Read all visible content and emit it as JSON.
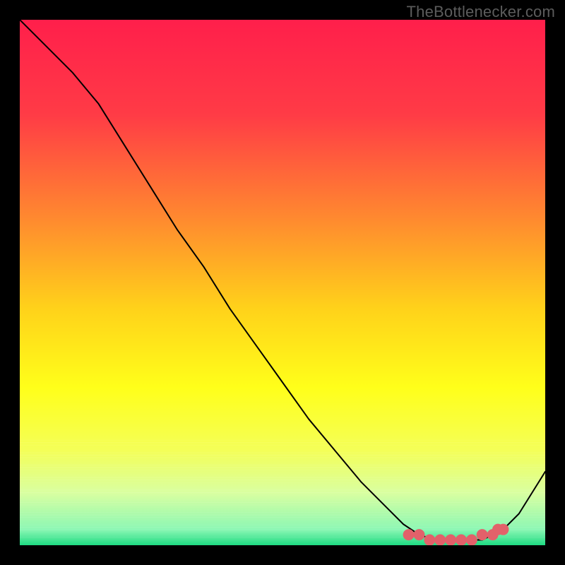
{
  "watermark": "TheBottlenecker.com",
  "chart_data": {
    "type": "line",
    "title": "",
    "xlabel": "",
    "ylabel": "",
    "xlim": [
      0,
      100
    ],
    "ylim": [
      0,
      100
    ],
    "grid": false,
    "series": [
      {
        "name": "curve",
        "x": [
          0,
          5,
          10,
          15,
          20,
          25,
          30,
          35,
          40,
          45,
          50,
          55,
          60,
          65,
          70,
          73,
          76,
          79,
          82,
          85,
          88,
          90,
          92,
          95,
          100
        ],
        "y": [
          100,
          95,
          90,
          84,
          76,
          68,
          60,
          53,
          45,
          38,
          31,
          24,
          18,
          12,
          7,
          4,
          2,
          1,
          1,
          1,
          1,
          2,
          3,
          6,
          14
        ]
      }
    ],
    "markers": {
      "name": "valley-points",
      "x": [
        74,
        76,
        78,
        80,
        82,
        84,
        86,
        88,
        90,
        91,
        92
      ],
      "y": [
        2,
        2,
        1,
        1,
        1,
        1,
        1,
        2,
        2,
        3,
        3
      ],
      "color": "#e2616a",
      "size": 8
    },
    "line_style": {
      "color": "#000000",
      "width": 2
    },
    "background": {
      "type": "custom-gradient",
      "stops": [
        {
          "offset": 0.0,
          "color": "#ff1f4b"
        },
        {
          "offset": 0.18,
          "color": "#ff3b46"
        },
        {
          "offset": 0.38,
          "color": "#ff8a2f"
        },
        {
          "offset": 0.55,
          "color": "#ffd21a"
        },
        {
          "offset": 0.7,
          "color": "#ffff1a"
        },
        {
          "offset": 0.82,
          "color": "#f4ff58"
        },
        {
          "offset": 0.9,
          "color": "#d9ffa0"
        },
        {
          "offset": 0.97,
          "color": "#8cf7b4"
        },
        {
          "offset": 1.0,
          "color": "#1edb82"
        }
      ]
    }
  }
}
